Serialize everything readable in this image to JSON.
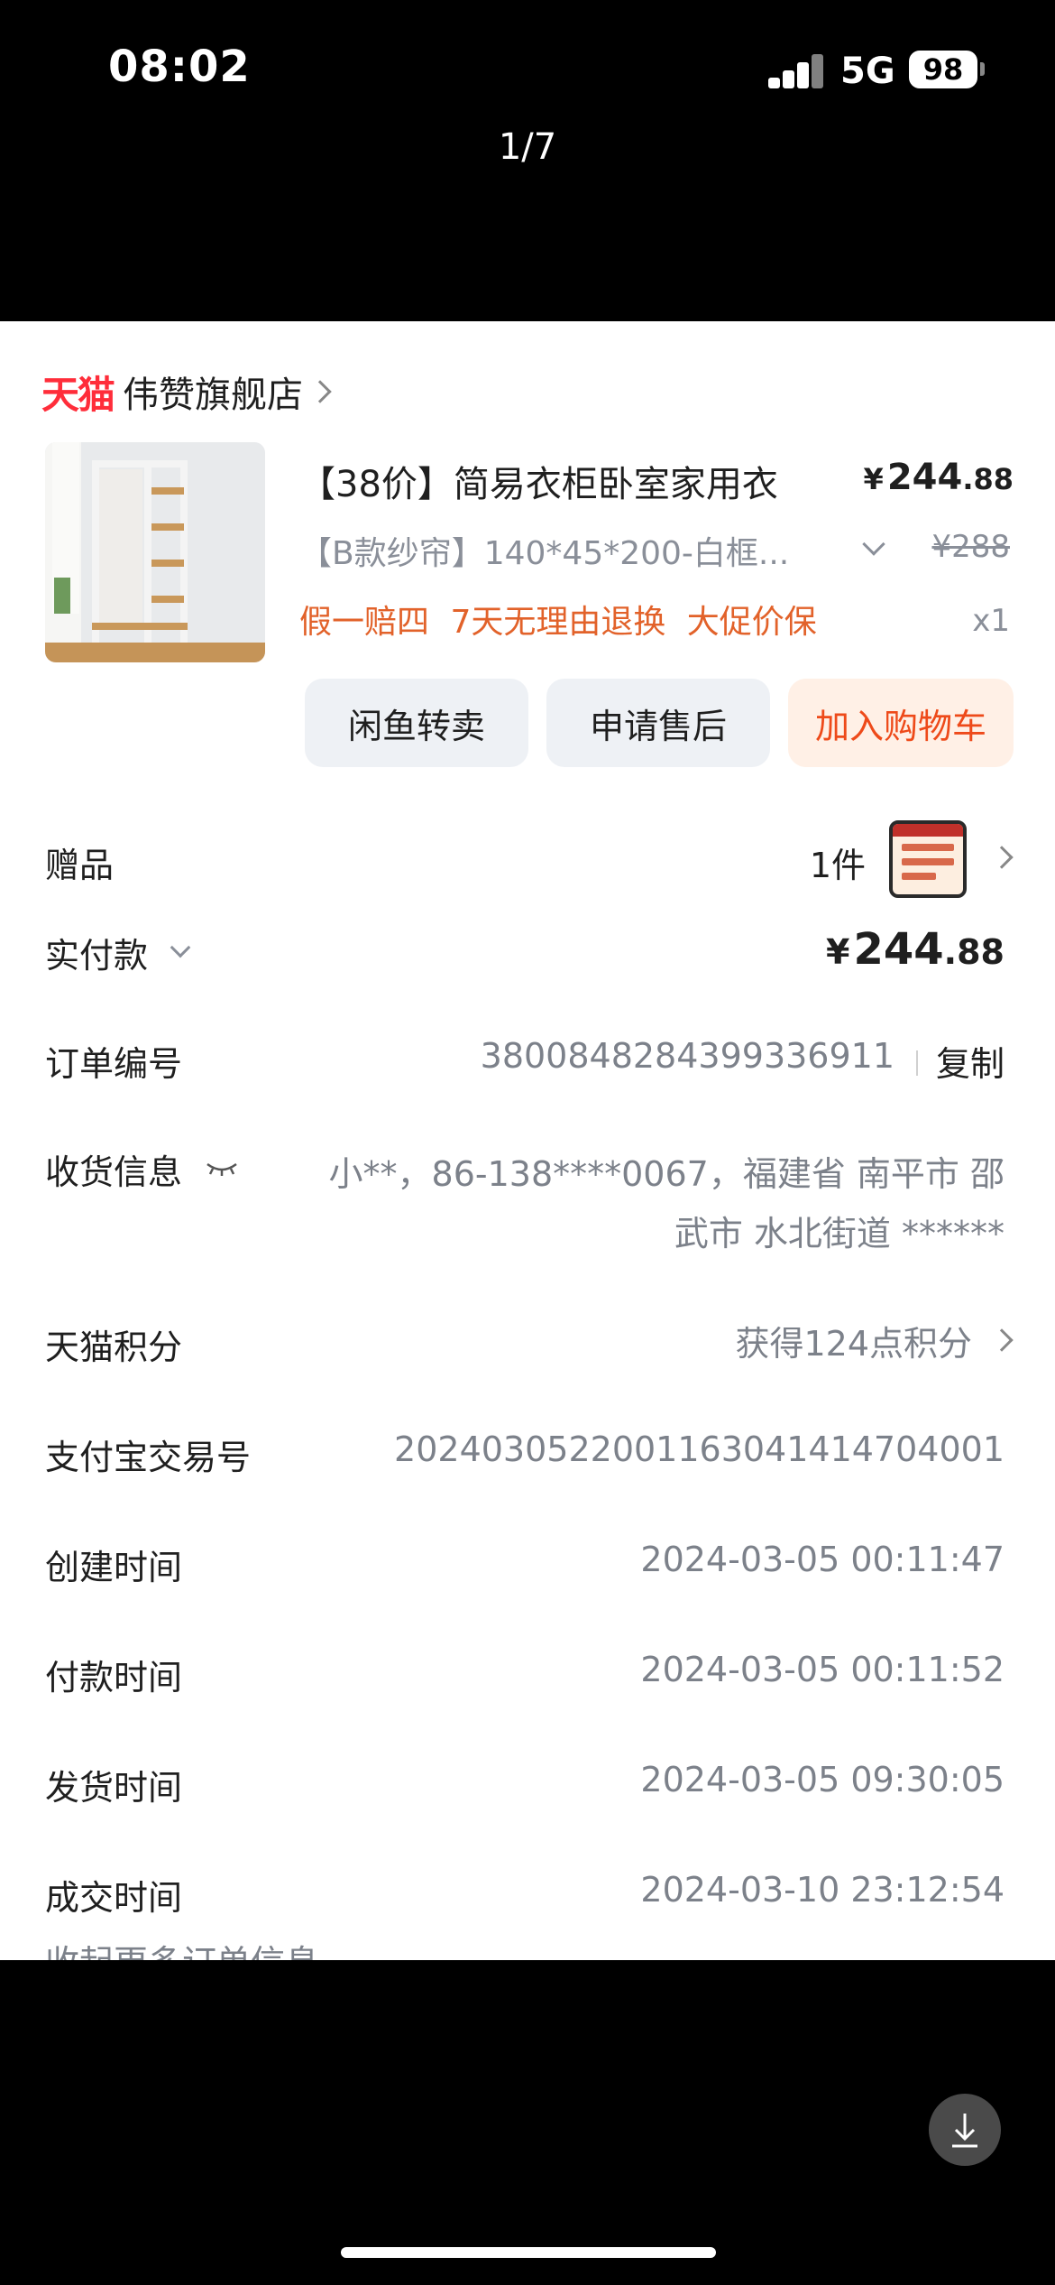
{
  "status_bar": {
    "time": "08:02",
    "network": "5G",
    "battery": "98"
  },
  "viewer": {
    "pager": "1/7"
  },
  "shop": {
    "logo_text": "天猫",
    "name": "伟赞旗舰店"
  },
  "product": {
    "title": "【38价】简易衣柜卧室家用衣",
    "price_yen": "¥",
    "price_int": "244",
    "price_cents": ".88",
    "sku": "【B款纱帘】140*45*200-白框...",
    "original_price": "¥288",
    "tags": "假一赔四 7天无理由退换 大促价保",
    "quantity": "x1"
  },
  "actions": {
    "resell": "闲鱼转卖",
    "after_sales": "申请售后",
    "add_cart": "加入购物车"
  },
  "gift": {
    "label": "赠品",
    "count": "1件"
  },
  "payment": {
    "label": "实付款",
    "yen": "¥",
    "int": "244",
    "cents": ".88"
  },
  "order": {
    "number_label": "订单编号",
    "number": "3800848284399336911",
    "copy_label": "复制",
    "address_label": "收货信息",
    "address": "小**，86-138****0067，福建省 南平市 邵武市 水北街道 ******",
    "points_label": "天猫积分",
    "points": "获得124点积分",
    "alipay_label": "支付宝交易号",
    "alipay_number": "2024030522001163041414704001",
    "created_label": "创建时间",
    "created": "2024-03-05 00:11:47",
    "paid_label": "付款时间",
    "paid": "2024-03-05 00:11:52",
    "shipped_label": "发货时间",
    "shipped": "2024-03-05 09:30:05",
    "completed_label": "成交时间",
    "completed": "2024-03-10 23:12:54",
    "collapse_label": "收起更多订单信息"
  },
  "icons": [
    "signal-icon",
    "battery-icon",
    "chevron-right-icon",
    "chevron-down-icon",
    "eye-closed-icon",
    "download-icon"
  ],
  "colors": {
    "tmall_red": "#ff2d3a",
    "tag_orange": "#e2622a",
    "cart_orange": "#ee4a1a",
    "cart_bg": "#fff0e6"
  }
}
